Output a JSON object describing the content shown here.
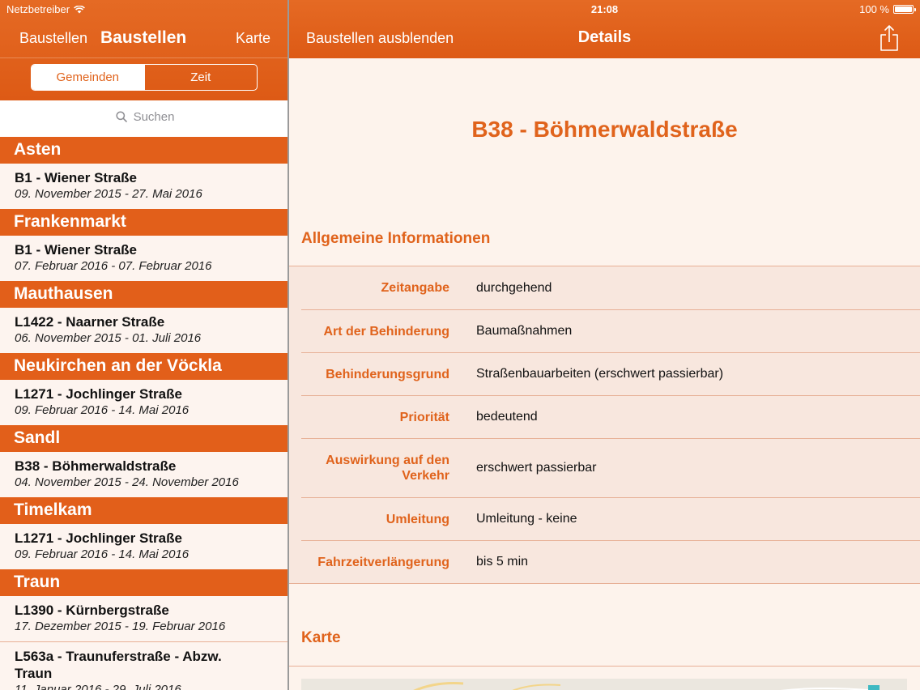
{
  "status": {
    "carrier": "Netzbetreiber",
    "time": "21:08",
    "battery": "100 %"
  },
  "master": {
    "back_label": "Baustellen",
    "title": "Baustellen",
    "map_button": "Karte",
    "segments": [
      "Gemeinden",
      "Zeit"
    ],
    "search_placeholder": "Suchen",
    "sections": [
      {
        "name": "Asten",
        "items": [
          {
            "title": "B1 - Wiener Straße",
            "dates": "09. November 2015 - 27. Mai 2016"
          }
        ]
      },
      {
        "name": "Frankenmarkt",
        "items": [
          {
            "title": "B1 - Wiener Straße",
            "dates": "07. Februar 2016 - 07. Februar 2016"
          }
        ]
      },
      {
        "name": "Mauthausen",
        "items": [
          {
            "title": "L1422 - Naarner Straße",
            "dates": "06. November 2015 - 01. Juli 2016"
          }
        ]
      },
      {
        "name": "Neukirchen an der Vöckla",
        "items": [
          {
            "title": "L1271 - Jochlinger Straße",
            "dates": "09. Februar 2016 - 14. Mai 2016"
          }
        ]
      },
      {
        "name": "Sandl",
        "items": [
          {
            "title": "B38 - Böhmerwaldstraße",
            "dates": "04. November 2015 - 24. November 2016"
          }
        ]
      },
      {
        "name": "Timelkam",
        "items": [
          {
            "title": "L1271 - Jochlinger Straße",
            "dates": "09. Februar 2016 - 14. Mai 2016"
          }
        ]
      },
      {
        "name": "Traun",
        "items": [
          {
            "title": "L1390 - Kürnbergstraße",
            "dates": "17. Dezember 2015 - 19. Februar 2016"
          },
          {
            "title": "L563a - Traunuferstraße - Abzw. Traun",
            "dates": "11. Januar 2016 - 29. Juli 2016"
          }
        ]
      }
    ]
  },
  "detail": {
    "hide_button": "Baustellen ausblenden",
    "nav_title": "Details",
    "title": "B38 - Böhmerwaldstraße",
    "general_section": "Allgemeine Informationen",
    "rows": [
      {
        "label": "Zeitangabe",
        "value": "durchgehend"
      },
      {
        "label": "Art der Behinderung",
        "value": "Baumaßnahmen"
      },
      {
        "label": "Behinderungsgrund",
        "value": "Straßenbauarbeiten (erschwert passierbar)"
      },
      {
        "label": "Priorität",
        "value": "bedeutend"
      },
      {
        "label": "Auswirkung auf den Verkehr",
        "value": "erschwert passierbar"
      },
      {
        "label": "Umleitung",
        "value": "Umleitung - keine"
      },
      {
        "label": "Fahrzeitverlängerung",
        "value": "bis 5 min"
      }
    ],
    "map_section": "Karte"
  },
  "colors": {
    "accent": "#e0631c",
    "header": "#e25f1a",
    "row_bg": "#fdf4ef"
  },
  "icons": {
    "search": "search-icon",
    "share": "share-icon",
    "wifi": "wifi-icon",
    "battery": "battery-icon"
  }
}
